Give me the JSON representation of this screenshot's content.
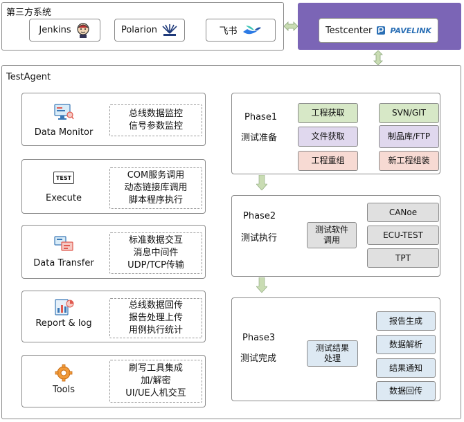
{
  "third_party": {
    "title": "第三方系统",
    "jenkins": "Jenkins",
    "polarion": "Polarion",
    "feishu": "飞书"
  },
  "testcenter": {
    "label": "Testcenter",
    "logo_text": "PAVELINK"
  },
  "agent": {
    "title": "TestAgent",
    "modules": [
      {
        "label": "Data Monitor",
        "icon": "monitor-icon",
        "lines": [
          "总线数据监控",
          "信号参数监控"
        ]
      },
      {
        "label": "Execute",
        "icon": "test-icon",
        "icon_text": "TEST",
        "lines": [
          "COM服务调用",
          "动态链接库调用",
          "脚本程序执行"
        ]
      },
      {
        "label": "Data Transfer",
        "icon": "transfer-icon",
        "lines": [
          "标准数据交互",
          "消息中间件",
          "UDP/TCP传输"
        ]
      },
      {
        "label": "Report & log",
        "icon": "report-icon",
        "lines": [
          "总线数据回传",
          "报告处理上传",
          "用例执行统计"
        ]
      },
      {
        "label": "Tools",
        "icon": "gear-icon",
        "lines": [
          "刷写工具集成",
          "加/解密",
          "UI/UE人机交互"
        ]
      }
    ]
  },
  "phases": [
    {
      "name": "Phase1",
      "sub": "测试准备",
      "tags": [
        "工程获取",
        "文件获取",
        "工程重组",
        "SVN/GIT",
        "制品库/FTP",
        "新工程组装"
      ]
    },
    {
      "name": "Phase2",
      "sub": "测试执行",
      "center": "测试软件调用",
      "tools": [
        "CANoe",
        "ECU-TEST",
        "TPT"
      ]
    },
    {
      "name": "Phase3",
      "sub": "测试完成",
      "center": "测试结果处理",
      "outputs": [
        "报告生成",
        "数据解析",
        "结果通知",
        "数据回传"
      ]
    }
  ],
  "colors": {
    "testcenter_bg": "#7b65b6",
    "tag_green": "#d7e8c7",
    "tag_lilac": "#e0d8ee",
    "tag_pink": "#f7dad3",
    "tag_grey": "#e0e0e0",
    "tag_blue": "#dde9f3",
    "arrow": "#c9dcb3"
  }
}
